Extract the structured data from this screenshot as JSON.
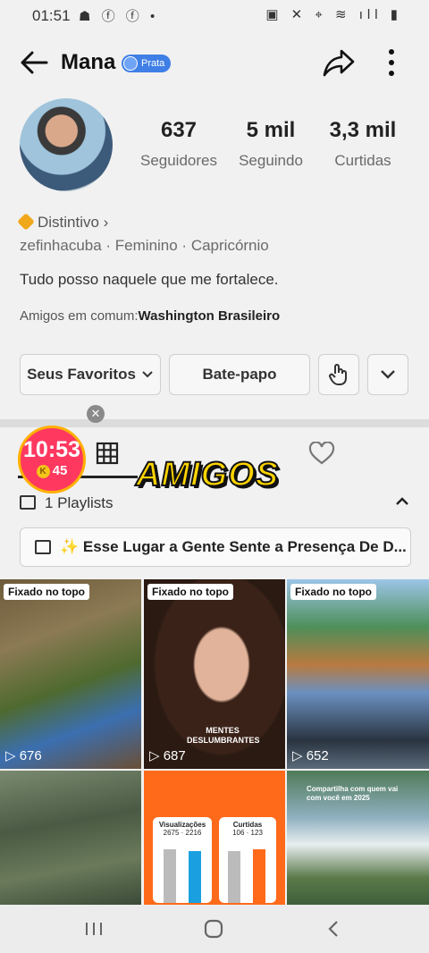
{
  "status_bar": {
    "time": "01:51",
    "left_icons": "☗ ⓕ ⓕ •",
    "right_icons": "▣ ✕ ⌖ ≋ ıll ▮"
  },
  "header": {
    "name": "Mana",
    "badge": "Prata"
  },
  "stats": [
    {
      "value": "637",
      "label": "Seguidores"
    },
    {
      "value": "5 mil",
      "label": "Seguindo"
    },
    {
      "value": "3,3 mil",
      "label": "Curtidas"
    }
  ],
  "profile": {
    "distintivo": "Distintivo ›",
    "meta": "zefinhacuba  ·  Feminino  ·  Capricórnio",
    "bio": "Tudo posso naquele que me fortalece.",
    "mutual_label": "Amigos em comum:",
    "mutual_name": "Washington Brasileiro"
  },
  "actions": {
    "favorites": "Seus Favoritos",
    "chat": "Bate-papo"
  },
  "timer": {
    "time": "10:53",
    "coins": "45"
  },
  "sticker_text": "AMIGOS",
  "playlists": {
    "count_label": "1 Playlists",
    "item": "✨ Esse Lugar a Gente Sente a Presença De D..."
  },
  "videos": [
    {
      "pinned": "Fixado no topo",
      "views": "676"
    },
    {
      "pinned": "Fixado no topo",
      "views": "687",
      "overlay": "MENTES DESLUMBRANTES"
    },
    {
      "pinned": "Fixado no topo",
      "views": "652"
    },
    {},
    {
      "stat1_label": "Visualizações",
      "stat1_a": "2675",
      "stat1_b": "2216",
      "stat2_label": "Curtidas",
      "stat2_a": "106",
      "stat2_b": "123"
    },
    {
      "caption": "Compartilha com quem vai com você em 2025"
    }
  ],
  "icons": [
    "back-arrow-icon",
    "share-icon",
    "more-vert-icon",
    "grid-icon",
    "heart-icon",
    "playlist-icon",
    "chevron-up-icon",
    "chevron-down-icon",
    "gift-hand-icon",
    "play-icon"
  ]
}
